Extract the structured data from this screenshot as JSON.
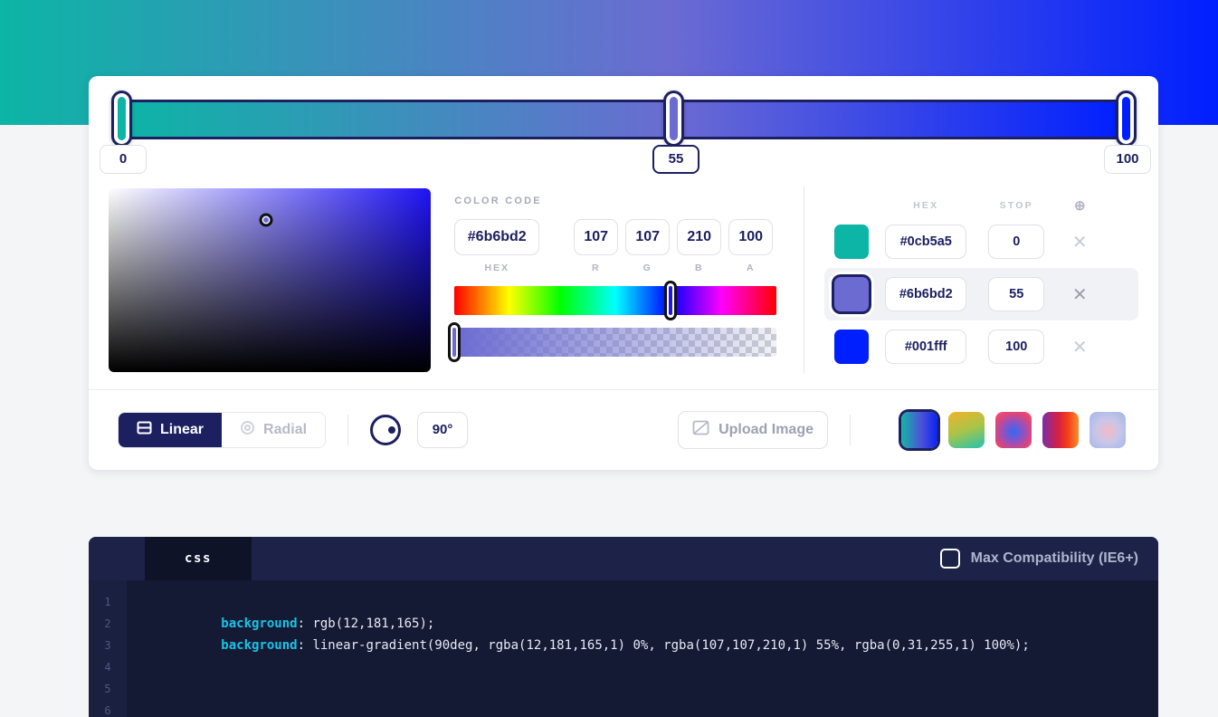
{
  "theme": {
    "accent_navy": "#1d2060",
    "page_bg": "#f4f5f7",
    "hero_gradient": "linear-gradient(90deg, rgba(12,181,165,1) 0%, rgba(107,107,210,1) 55%, rgba(0,31,255,1) 100%)"
  },
  "gradient_bar": {
    "css": "linear-gradient(90deg, rgba(12,181,165,1) 0%, rgba(107,107,210,1) 55%, rgba(0,31,255,1) 100%)",
    "handles": [
      {
        "name": "stop-handle-0",
        "value": "0",
        "percent": 0,
        "color": "#0cb5a5"
      },
      {
        "name": "stop-handle-1",
        "value": "55",
        "percent": 55,
        "color": "#6b6bd2",
        "selected": true
      },
      {
        "name": "stop-handle-2",
        "value": "100",
        "percent": 100,
        "color": "#001fff"
      }
    ]
  },
  "color_code": {
    "section_label": "Color Code",
    "hex_value": "#6b6bd2",
    "hex_label": "HEX",
    "r_value": "107",
    "r_label": "R",
    "g_value": "107",
    "g_label": "G",
    "b_value": "210",
    "b_label": "B",
    "a_value": "100",
    "a_label": "A",
    "hue_position_pct": 67,
    "alpha_position_pct": 0
  },
  "picker": {
    "base_color": "#1f13f5",
    "cursor_x_pct": 48.9,
    "cursor_y_pct": 17.2,
    "current_color": "#6b6bd2"
  },
  "stops_panel": {
    "headers": {
      "swatch": "",
      "hex": "HEX",
      "stop": "STOP",
      "add": "⊕"
    },
    "rows": [
      {
        "swatch": "#0cb5a5",
        "hex": "#0cb5a5",
        "stop": "0",
        "remove": "✕",
        "selected": false
      },
      {
        "swatch": "#6b6bd2",
        "hex": "#6b6bd2",
        "stop": "55",
        "remove": "✕",
        "selected": true
      },
      {
        "swatch": "#001fff",
        "hex": "#001fff",
        "stop": "100",
        "remove": "✕",
        "selected": false
      }
    ]
  },
  "toolbar": {
    "linear_label": "Linear",
    "radial_label": "Radial",
    "active_type": "Linear",
    "angle_value": "90°",
    "upload_label": "Upload Image",
    "presets": [
      {
        "name": "preset-teal-blue",
        "css": "linear-gradient(90deg,#15b5a6 0%,#4b53d8 55%,#0b23f2 100%)",
        "selected": true
      },
      {
        "name": "preset-yellow-teal",
        "css": "linear-gradient(160deg,#f0b429 0%,#a8c44a 50%,#21c4b0 100%)",
        "selected": false
      },
      {
        "name": "preset-pink-blue-radial",
        "css": "radial-gradient(circle at 50% 55%, #2f6bf0 0%, #8a52c8 35%, #e8456f 75%, #f05a7e 100%)",
        "selected": false
      },
      {
        "name": "preset-purple-red-orange",
        "css": "linear-gradient(90deg,#7b2ea8 0%,#d8203f 45%,#f43f17 70%,#f98c2e 100%)",
        "selected": false
      },
      {
        "name": "preset-light-blue-pink",
        "css": "radial-gradient(circle at 50% 52%, #f3b9c6 0%, #c9c6e8 45%, #9fb6e8 100%)",
        "selected": false
      }
    ]
  },
  "code_panel": {
    "tab_label": "css",
    "compat_label": "Max Compatibility (IE6+)",
    "compat_checked": false,
    "line_numbers": [
      "1",
      "2",
      "3",
      "4",
      "5",
      "6"
    ],
    "lines": [
      {
        "keyword": "background",
        "rest": ": rgb(12,181,165);"
      },
      {
        "keyword": "background",
        "rest": ": linear-gradient(90deg, rgba(12,181,165,1) 0%, rgba(107,107,210,1) 55%, rgba(0,31,255,1) 100%);"
      }
    ]
  }
}
